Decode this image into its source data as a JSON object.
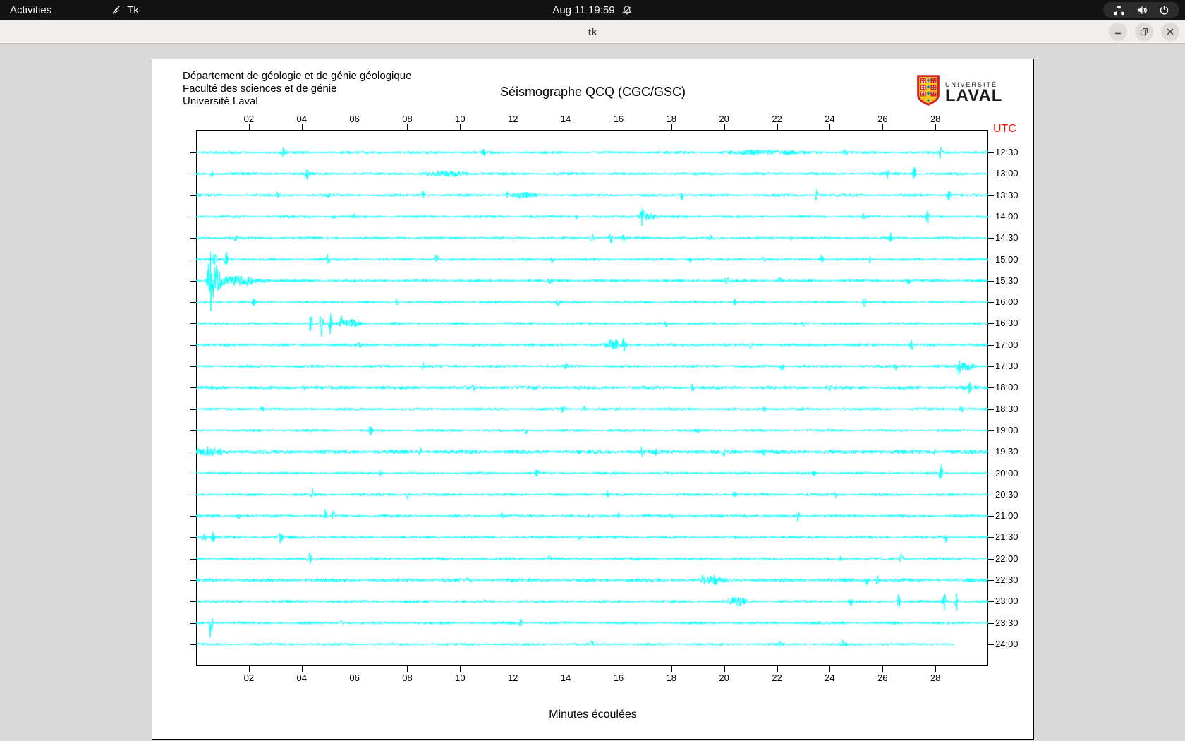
{
  "top_bar": {
    "activities": "Activities",
    "app_name": "Tk",
    "clock": "Aug 11 19:59",
    "icons": [
      "tk-feather-icon",
      "notifications-off-icon",
      "network-wired-icon",
      "volume-icon",
      "power-icon"
    ]
  },
  "window": {
    "title": "tk",
    "controls": [
      "minimize",
      "restore",
      "close"
    ]
  },
  "chart_data": {
    "type": "line",
    "subtype": "helicorder-seismogram",
    "title": "Séismographe QCQ (CGC/GSC)",
    "header_lines": [
      "Département de géologie et de génie géologique",
      "Faculté des sciences et de génie",
      "Université Laval"
    ],
    "logo": {
      "univ": "UNIVERSITÉ",
      "laval": "LAVAL"
    },
    "utc_label": "UTC",
    "xlabel": "Minutes écoulées",
    "x_range": [
      0,
      30
    ],
    "x_ticks": [
      "02",
      "04",
      "06",
      "08",
      "10",
      "12",
      "14",
      "16",
      "18",
      "20",
      "22",
      "24",
      "26",
      "28"
    ],
    "trace_color": "#00ffff",
    "utc_color": "#ff0f0a",
    "rows": [
      {
        "time": "12:30",
        "amp": 1.6,
        "end": 30,
        "events": [
          [
            3.3,
            6
          ],
          [
            10.9,
            5
          ],
          [
            21.5,
            2.5,
            1.2
          ],
          [
            24.6,
            6
          ],
          [
            28.2,
            13
          ]
        ]
      },
      {
        "time": "13:00",
        "amp": 1.7,
        "end": 30,
        "events": [
          [
            0.6,
            4
          ],
          [
            4.2,
            7
          ],
          [
            9.5,
            2.5,
            0.8
          ],
          [
            26.2,
            6
          ],
          [
            27.2,
            11
          ]
        ]
      },
      {
        "time": "13:30",
        "amp": 1.6,
        "end": 30,
        "events": [
          [
            3.1,
            5
          ],
          [
            5.0,
            4
          ],
          [
            8.6,
            6
          ],
          [
            11.8,
            4
          ],
          [
            12.4,
            3,
            0.4
          ],
          [
            18.4,
            7
          ],
          [
            23.5,
            7
          ],
          [
            28.5,
            10
          ]
        ]
      },
      {
        "time": "14:00",
        "amp": 1.6,
        "end": 30,
        "events": [
          [
            5.2,
            4
          ],
          [
            6.0,
            4
          ],
          [
            14.4,
            3
          ],
          [
            16.9,
            12
          ],
          [
            17.1,
            5,
            0.3
          ],
          [
            25.3,
            5
          ],
          [
            27.7,
            8
          ]
        ]
      },
      {
        "time": "14:30",
        "amp": 1.6,
        "end": 30,
        "events": [
          [
            1.5,
            5
          ],
          [
            15.0,
            6
          ],
          [
            15.7,
            9
          ],
          [
            16.2,
            6
          ],
          [
            19.5,
            4
          ],
          [
            22.5,
            4
          ],
          [
            26.3,
            6
          ]
        ]
      },
      {
        "time": "15:00",
        "amp": 1.7,
        "end": 30,
        "events": [
          [
            0.7,
            9
          ],
          [
            1.15,
            12
          ],
          [
            5.0,
            6
          ],
          [
            9.1,
            7
          ],
          [
            13.5,
            4
          ],
          [
            18.7,
            5
          ],
          [
            21.5,
            5
          ],
          [
            23.7,
            5
          ],
          [
            25.5,
            4
          ]
        ]
      },
      {
        "time": "15:30",
        "amp": 1.8,
        "end": 30,
        "events": [
          [
            0.55,
            42,
            0.1
          ],
          [
            0.8,
            18,
            0.15
          ],
          [
            1.6,
            6,
            0.8
          ],
          [
            13.4,
            6
          ],
          [
            20.1,
            8
          ],
          [
            22.1,
            6
          ],
          [
            27.0,
            4
          ]
        ]
      },
      {
        "time": "16:00",
        "amp": 1.6,
        "end": 30,
        "events": [
          [
            2.2,
            5
          ],
          [
            7.6,
            3
          ],
          [
            13.7,
            5
          ],
          [
            20.4,
            4
          ],
          [
            25.3,
            6
          ]
        ]
      },
      {
        "time": "16:30",
        "amp": 1.6,
        "end": 30,
        "events": [
          [
            4.35,
            13
          ],
          [
            4.75,
            21
          ],
          [
            5.1,
            17
          ],
          [
            5.5,
            9
          ],
          [
            5.9,
            5,
            0.3
          ],
          [
            17.8,
            5
          ],
          [
            23.0,
            3
          ]
        ]
      },
      {
        "time": "17:00",
        "amp": 1.7,
        "end": 30,
        "events": [
          [
            6.2,
            3
          ],
          [
            15.8,
            7,
            0.25
          ],
          [
            16.2,
            8
          ],
          [
            21.0,
            3
          ],
          [
            27.1,
            7
          ]
        ]
      },
      {
        "time": "17:30",
        "amp": 1.7,
        "end": 30,
        "events": [
          [
            8.6,
            5
          ],
          [
            14.0,
            4
          ],
          [
            22.2,
            9
          ],
          [
            26.5,
            4
          ],
          [
            28.9,
            10
          ],
          [
            29.2,
            5,
            0.3
          ]
        ]
      },
      {
        "time": "18:00",
        "amp": 2.0,
        "end": 30,
        "events": [
          [
            4.1,
            4
          ],
          [
            10.5,
            3
          ],
          [
            18.8,
            6
          ],
          [
            24.0,
            3
          ],
          [
            29.3,
            9
          ]
        ]
      },
      {
        "time": "18:30",
        "amp": 1.6,
        "end": 30,
        "events": [
          [
            2.5,
            3
          ],
          [
            13.9,
            7
          ],
          [
            14.7,
            5
          ],
          [
            21.5,
            4
          ],
          [
            29.0,
            7
          ]
        ]
      },
      {
        "time": "19:00",
        "amp": 1.5,
        "end": 30,
        "events": [
          [
            6.6,
            7
          ],
          [
            12.5,
            4
          ],
          [
            19.0,
            3
          ],
          [
            24.0,
            3
          ]
        ]
      },
      {
        "time": "19:30",
        "amp": 2.6,
        "end": 30,
        "events": [
          [
            0.5,
            4,
            0.5
          ],
          [
            8.5,
            5
          ],
          [
            16.9,
            6
          ],
          [
            17.4,
            5
          ],
          [
            20.0,
            4
          ],
          [
            21.5,
            4
          ],
          [
            28.0,
            4
          ]
        ]
      },
      {
        "time": "20:00",
        "amp": 1.6,
        "end": 30,
        "events": [
          [
            7.0,
            3
          ],
          [
            12.9,
            4
          ],
          [
            23.4,
            4
          ],
          [
            28.2,
            16
          ]
        ]
      },
      {
        "time": "20:30",
        "amp": 1.6,
        "end": 30,
        "events": [
          [
            4.4,
            7
          ],
          [
            8.0,
            7
          ],
          [
            15.6,
            5
          ],
          [
            20.4,
            4
          ],
          [
            24.2,
            4
          ]
        ]
      },
      {
        "time": "21:00",
        "amp": 1.7,
        "end": 30,
        "events": [
          [
            1.6,
            4
          ],
          [
            4.9,
            9
          ],
          [
            5.2,
            6
          ],
          [
            11.6,
            5
          ],
          [
            16.0,
            4
          ],
          [
            18.0,
            4
          ],
          [
            20.8,
            4
          ],
          [
            22.8,
            8
          ]
        ]
      },
      {
        "time": "21:30",
        "amp": 1.7,
        "end": 30,
        "events": [
          [
            0.3,
            8
          ],
          [
            0.65,
            6
          ],
          [
            3.2,
            9
          ],
          [
            14.5,
            3
          ],
          [
            28.4,
            6
          ]
        ]
      },
      {
        "time": "22:00",
        "amp": 1.7,
        "end": 30,
        "events": [
          [
            4.3,
            8
          ],
          [
            13.4,
            4
          ],
          [
            24.4,
            4
          ],
          [
            26.7,
            8
          ]
        ]
      },
      {
        "time": "22:30",
        "amp": 2.0,
        "end": 30,
        "events": [
          [
            10.3,
            3
          ],
          [
            19.2,
            9
          ],
          [
            19.6,
            5,
            0.3
          ],
          [
            25.4,
            6
          ],
          [
            25.8,
            6
          ]
        ]
      },
      {
        "time": "23:00",
        "amp": 1.7,
        "end": 30,
        "events": [
          [
            20.5,
            5,
            0.3
          ],
          [
            24.8,
            5
          ],
          [
            26.6,
            10
          ],
          [
            28.35,
            15
          ],
          [
            28.8,
            13
          ]
        ]
      },
      {
        "time": "23:30",
        "amp": 1.6,
        "end": 30,
        "events": [
          [
            0.56,
            24
          ],
          [
            5.5,
            4
          ],
          [
            12.3,
            5
          ],
          [
            24.5,
            4
          ]
        ]
      },
      {
        "time": "24:00",
        "amp": 1.5,
        "end": 28.7,
        "events": [
          [
            15.0,
            4
          ],
          [
            22.1,
            6
          ],
          [
            24.5,
            6
          ]
        ]
      }
    ]
  }
}
